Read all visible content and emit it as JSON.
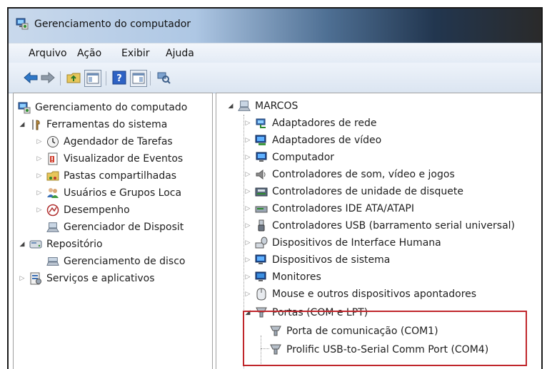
{
  "window": {
    "title": "Gerenciamento do computador"
  },
  "menu": {
    "items": [
      "Arquivo",
      "Ação",
      "Exibir",
      "Ajuda"
    ]
  },
  "left_tree": {
    "root": "Gerenciamento do computado",
    "system_tools": "Ferramentas do sistema",
    "tools": [
      "Agendador de Tarefas",
      "Visualizador de Eventos",
      "Pastas compartilhadas",
      "Usuários e Grupos Loca",
      "Desempenho",
      "Gerenciador de Disposit"
    ],
    "storage": "Repositório",
    "disk": "Gerenciamento de disco",
    "services": "Serviços e aplicativos"
  },
  "device_tree": {
    "computer": "MARCOS",
    "categories": [
      "Adaptadores de rede",
      "Adaptadores de vídeo",
      "Computador",
      "Controladores de som, vídeo e jogos",
      "Controladores de unidade de disquete",
      "Controladores IDE ATA/ATAPI",
      "Controladores USB (barramento serial universal)",
      "Dispositivos de Interface Humana",
      "Dispositivos de sistema",
      "Monitores",
      "Mouse e outros dispositivos apontadores",
      "Portas (COM e LPT)"
    ],
    "ports": [
      "Porta de comunicação (COM1)",
      "Prolific USB-to-Serial Comm Port (COM4)"
    ]
  },
  "colors": {
    "highlight": "#c0262b",
    "tree_arrow": "#444444"
  }
}
